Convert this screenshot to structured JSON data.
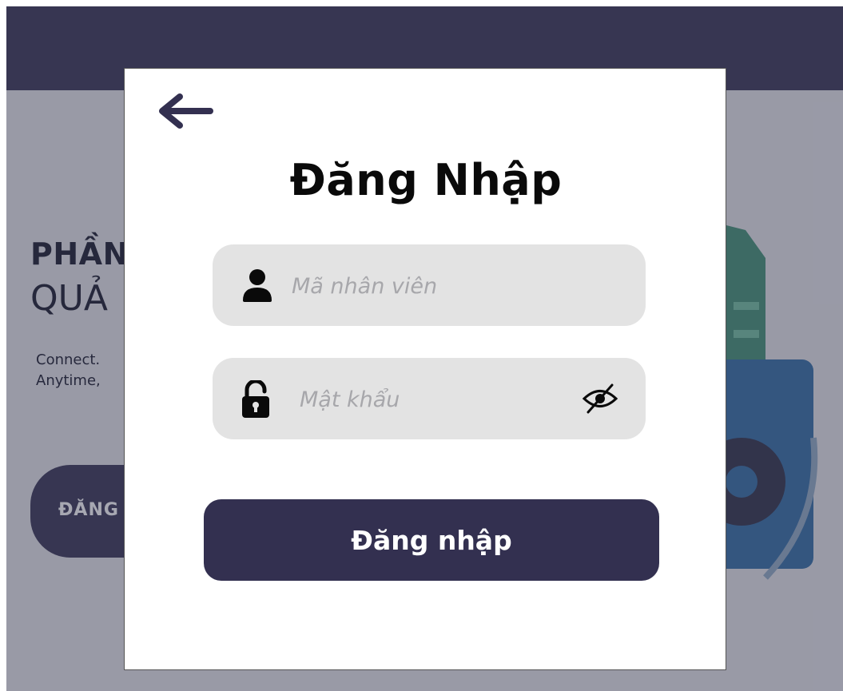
{
  "background": {
    "hero_title_bold": "PHẦN",
    "hero_title_light": "QUẢ",
    "hero_desc_line1": "Connect.",
    "hero_desc_line2": "Anytime,",
    "hero_button_label": "ĐĂNG"
  },
  "login_modal": {
    "back_icon": "arrow-left-icon",
    "title": "Đăng Nhập",
    "employee_id": {
      "icon": "user-icon",
      "placeholder": "Mã nhân viên",
      "value": ""
    },
    "password": {
      "icon": "unlock-icon",
      "placeholder": "Mật khẩu",
      "value": "",
      "toggle_icon": "eye-slash-icon"
    },
    "submit_label": "Đăng nhập"
  },
  "colors": {
    "primary": "#333050",
    "input_bg": "#e3e3e3",
    "placeholder": "#a7a7ab",
    "title": "#0a0a0a"
  }
}
